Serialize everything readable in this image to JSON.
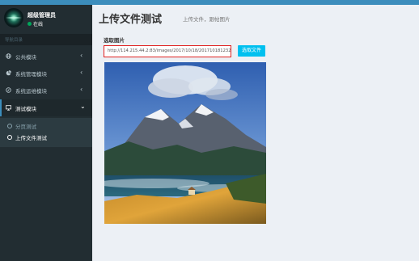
{
  "user": {
    "name": "超级管理员",
    "status": "在线"
  },
  "sidebar": {
    "header": "导航目录",
    "items": [
      {
        "label": "公共模块",
        "icon": "globe-icon",
        "chevron": "‹"
      },
      {
        "label": "系统管理模块",
        "icon": "pie-chart-icon",
        "chevron": "‹"
      },
      {
        "label": "系统运维模块",
        "icon": "compass-icon",
        "chevron": "‹"
      },
      {
        "label": "测试模块",
        "icon": "monitor-icon",
        "chevron": "⌄"
      }
    ],
    "submenu": [
      {
        "label": "分页测试"
      },
      {
        "label": "上传文件测试"
      }
    ]
  },
  "main": {
    "title": "上传文件测试",
    "subtitle": "上传文件，跟帖图片",
    "field_label": "选取图片",
    "url_value": "http://114.215.44.2:83/images/2017/10/18/201710181232133",
    "select_button": "选取文件"
  },
  "colors": {
    "sidebar_bg": "#222d32",
    "topbar": "#3c8dbc",
    "button": "#00c0ef",
    "highlight_border": "#e02020",
    "status_online": "#00a65a"
  }
}
